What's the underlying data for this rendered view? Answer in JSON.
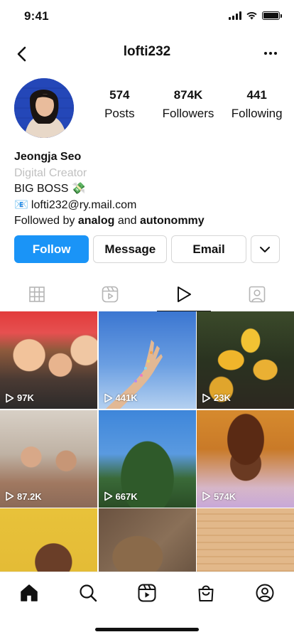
{
  "status_bar": {
    "time": "9:41"
  },
  "header": {
    "username": "lofti232"
  },
  "stats": [
    {
      "value": "574",
      "label": "Posts"
    },
    {
      "value": "874K",
      "label": "Followers"
    },
    {
      "value": "441",
      "label": "Following"
    }
  ],
  "bio": {
    "name": "Jeongja Seo",
    "category": "Digital Creator",
    "line1": "BIG BOSS 💸",
    "email_icon": "📧",
    "email": "lofti232@ry.mail.com",
    "followed_by_prefix": "Followed by",
    "followed_user_1": "analog",
    "followed_and": "and",
    "followed_user_2": "autonommy"
  },
  "actions": {
    "follow": "Follow",
    "message": "Message",
    "email": "Email"
  },
  "tabs": [
    "grid-icon",
    "reels-icon",
    "play-icon",
    "tagged-icon"
  ],
  "active_tab": 2,
  "grid": [
    {
      "views": "97K"
    },
    {
      "views": "441K"
    },
    {
      "views": "23K"
    },
    {
      "views": "87.2K"
    },
    {
      "views": "667K"
    },
    {
      "views": "574K"
    },
    {
      "views": ""
    },
    {
      "views": ""
    },
    {
      "views": ""
    }
  ],
  "bottom_nav": [
    "home-icon",
    "search-icon",
    "reels-icon",
    "shop-icon",
    "profile-icon"
  ],
  "colors": {
    "accent": "#1a94f7",
    "text": "#111111",
    "muted": "#c0c0c0"
  }
}
